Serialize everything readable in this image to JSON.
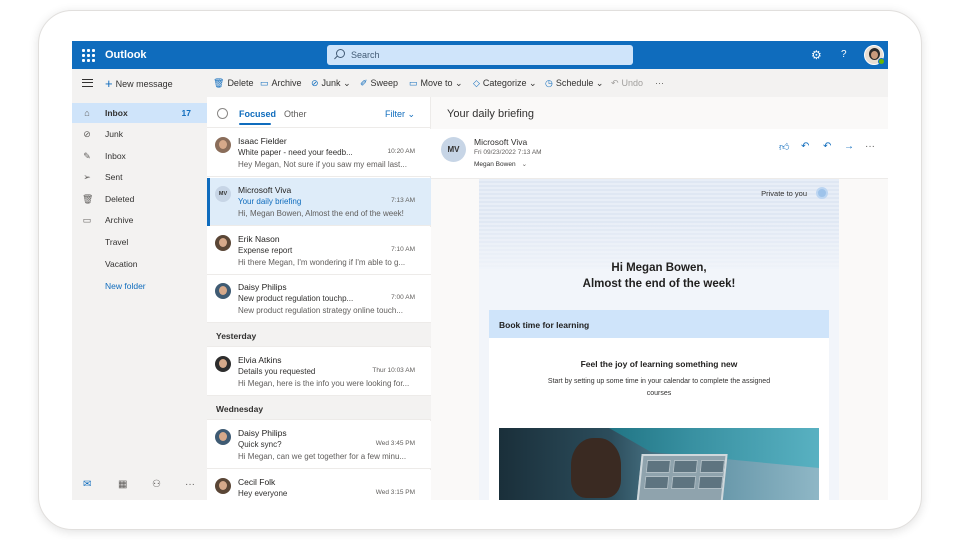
{
  "app": {
    "name": "Outlook"
  },
  "search": {
    "placeholder": "Search"
  },
  "topbar_icons": [
    "gear-icon",
    "help-icon"
  ],
  "commands": {
    "new_message": "New message",
    "delete": "Delete",
    "archive": "Archive",
    "junk": "Junk",
    "sweep": "Sweep",
    "move_to": "Move to",
    "categorize": "Categorize",
    "schedule": "Schedule",
    "undo": "Undo",
    "more": "···"
  },
  "sidebar": {
    "items": [
      {
        "label": "Inbox",
        "count": "17",
        "icon": "inbox-icon"
      },
      {
        "label": "Junk",
        "icon": "junk-icon"
      },
      {
        "label": "Inbox",
        "icon": "pencil-icon"
      },
      {
        "label": "Sent",
        "icon": "sent-icon"
      },
      {
        "label": "Deleted",
        "icon": "trash-icon"
      },
      {
        "label": "Archive",
        "icon": "archive-icon"
      },
      {
        "label": "Travel"
      },
      {
        "label": "Vacation"
      },
      {
        "label": "New folder"
      }
    ],
    "bottom_icons": [
      "mail-icon",
      "calendar-icon",
      "people-icon",
      "more-icon"
    ]
  },
  "list": {
    "tab_focused": "Focused",
    "tab_other": "Other",
    "filter": "Filter",
    "section_yesterday": "Yesterday",
    "section_wednesday": "Wednesday",
    "messages": [
      {
        "from": "Isaac Fielder",
        "subject": "White paper - need your feedb...",
        "time": "10:20 AM",
        "preview": "Hey Megan, Not sure if you saw my email last..."
      },
      {
        "from": "Microsoft Viva",
        "subject": "Your daily briefing",
        "time": "7:13 AM",
        "preview": "Hi, Megan Bowen, Almost the end of the week!",
        "initials": "MV"
      },
      {
        "from": "Erik Nason",
        "subject": "Expense report",
        "time": "7:10 AM",
        "preview": "Hi there Megan, I'm wondering if I'm able to g..."
      },
      {
        "from": "Daisy Philips",
        "subject": "New product regulation touchp...",
        "time": "7:00 AM",
        "preview": "New product regulation strategy online touch..."
      },
      {
        "from": "Elvia Atkins",
        "subject": "Details you requested",
        "time": "Thur 10:03 AM",
        "preview": "Hi Megan, here is the info you were looking for..."
      },
      {
        "from": "Daisy Philips",
        "subject": "Quick sync?",
        "time": "Wed 3:45 PM",
        "preview": "Hi Megan, can we get together for a few minu..."
      },
      {
        "from": "Cecil Folk",
        "subject": "Hey everyone",
        "time": "Wed 3:15 PM",
        "preview": ""
      }
    ]
  },
  "reading": {
    "title": "Your daily briefing",
    "from": "Microsoft Viva",
    "initials": "MV",
    "date": "Fri 09/23/2022 7:13 AM",
    "to": "Megan Bowen",
    "more": "···",
    "private": "Private to you",
    "greeting_line1": "Hi Megan Bowen,",
    "greeting_line2": "Almost the end of the week!",
    "book_title": "Book time for learning",
    "learn_heading": "Feel the joy of learning something new",
    "learn_body": "Start by setting up some time in your calendar to complete the assigned courses"
  },
  "colors": {
    "brand": "#0f6cbd",
    "selected": "#cfe4fa",
    "light": "#deecf9"
  }
}
